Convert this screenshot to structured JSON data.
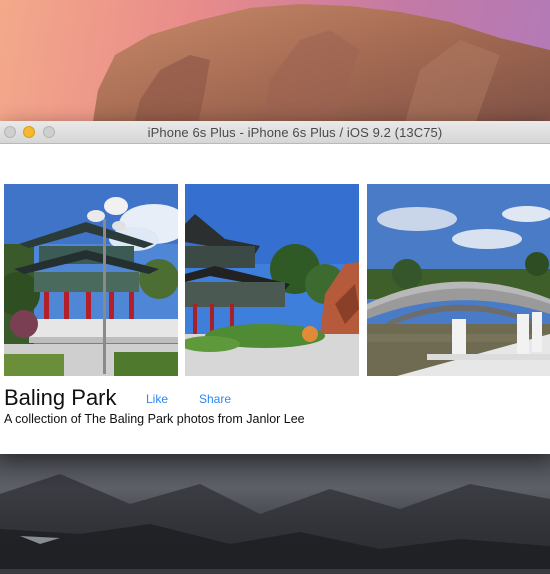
{
  "window": {
    "title": "iPhone 6s Plus - iPhone 6s Plus / iOS 9.2 (13C75)"
  },
  "album": {
    "title": "Baling Park",
    "like_label": "Like",
    "share_label": "Share",
    "description": "A collection of The Baling Park photos from Janlor Lee"
  },
  "photos": [
    {
      "subject": "pagoda-pavilion-with-lamp-post"
    },
    {
      "subject": "pagoda-roof-and-rock-garden"
    },
    {
      "subject": "arched-bridge-over-lake"
    }
  ],
  "colors": {
    "accent": "#2f86f0",
    "minimize": "#f5b82e"
  }
}
